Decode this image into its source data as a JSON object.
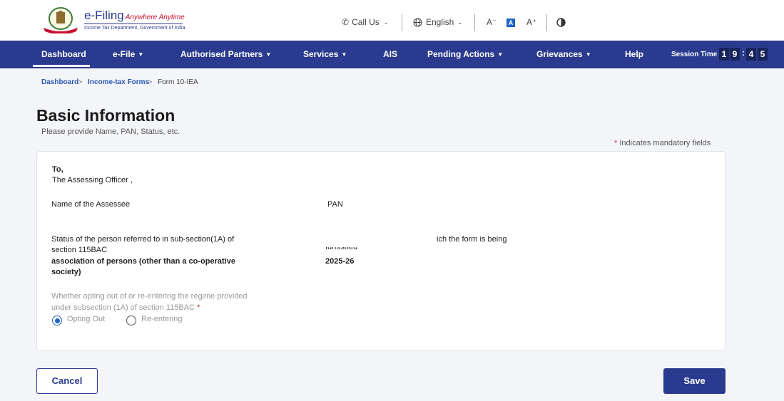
{
  "header": {
    "brand_name": "e-Filing",
    "brand_tagline": "Anywhere Anytime",
    "brand_dept": "Income Tax Department, Government of India",
    "call_us": "Call Us",
    "language": "English",
    "font_decrease": "A⁻",
    "font_normal": "A",
    "font_increase": "A⁺"
  },
  "nav": {
    "items": [
      {
        "label": "Dashboard"
      },
      {
        "label": "e-File"
      },
      {
        "label": "Authorised Partners"
      },
      {
        "label": "Services"
      },
      {
        "label": "AIS"
      },
      {
        "label": "Pending Actions"
      },
      {
        "label": "Grievances"
      },
      {
        "label": "Help"
      }
    ],
    "session_label": "Session Time",
    "session_digits": [
      "1",
      "9",
      "4",
      "5"
    ],
    "session_colon": ":"
  },
  "breadcrumb": {
    "items": [
      "Dashboard",
      "Income-tax Forms",
      "Form 10-IEA"
    ],
    "separator": ">"
  },
  "page": {
    "title": "Basic Information",
    "subtitle": "Please provide Name, PAN, Status, etc.",
    "mandatory_star": "*",
    "mandatory_note": "Indicates mandatory fields"
  },
  "form": {
    "to_label": "To,",
    "officer": "The Assessing Officer ,",
    "name_label": "Name of the Assessee",
    "pan_label": "PAN",
    "status_label_1": "Status of the person referred to in sub-section(1A) of",
    "status_label_2": "section 115BAC",
    "status_value_1": "association of persons (other than a co-operative",
    "status_value_2": "society)",
    "ay_partial": "ich the form is being",
    "ay_partial_2": "furnished",
    "ay_value": "2025-26",
    "opting_label_1": "Whether opting out of or re-entering the regime provided",
    "opting_label_2": "under subsection (1A) of section 115BAC",
    "opting_star": "*",
    "option_out": "Opting Out",
    "option_in": "Re-entering"
  },
  "actions": {
    "cancel": "Cancel",
    "save": "Save"
  },
  "colors": {
    "nav_bg": "#2a3b8f",
    "accent": "#1f64c7",
    "required": "#d9262e"
  }
}
